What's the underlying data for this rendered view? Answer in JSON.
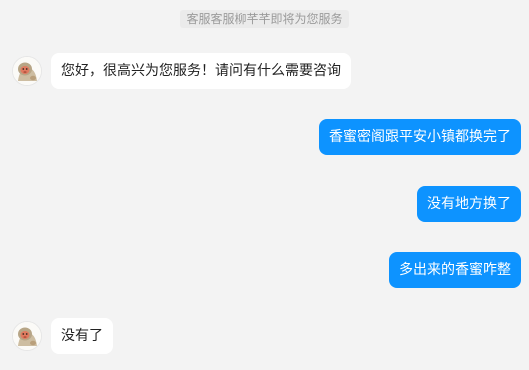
{
  "system_notice": "客服客服柳芊芊即将为您服务",
  "messages": [
    {
      "sender": "agent",
      "text": "您好，很高兴为您服务！请问有什么需要咨询"
    },
    {
      "sender": "user",
      "text": "香蜜密阁跟平安小镇都换完了"
    },
    {
      "sender": "user",
      "text": "没有地方换了"
    },
    {
      "sender": "user",
      "text": "多出来的香蜜咋整"
    },
    {
      "sender": "agent",
      "text": "没有了"
    }
  ],
  "colors": {
    "background": "#f3f3f3",
    "user_bubble": "#0d93ff",
    "agent_bubble": "#ffffff"
  },
  "icons": {
    "agent_avatar": "monkey-avatar-icon"
  }
}
